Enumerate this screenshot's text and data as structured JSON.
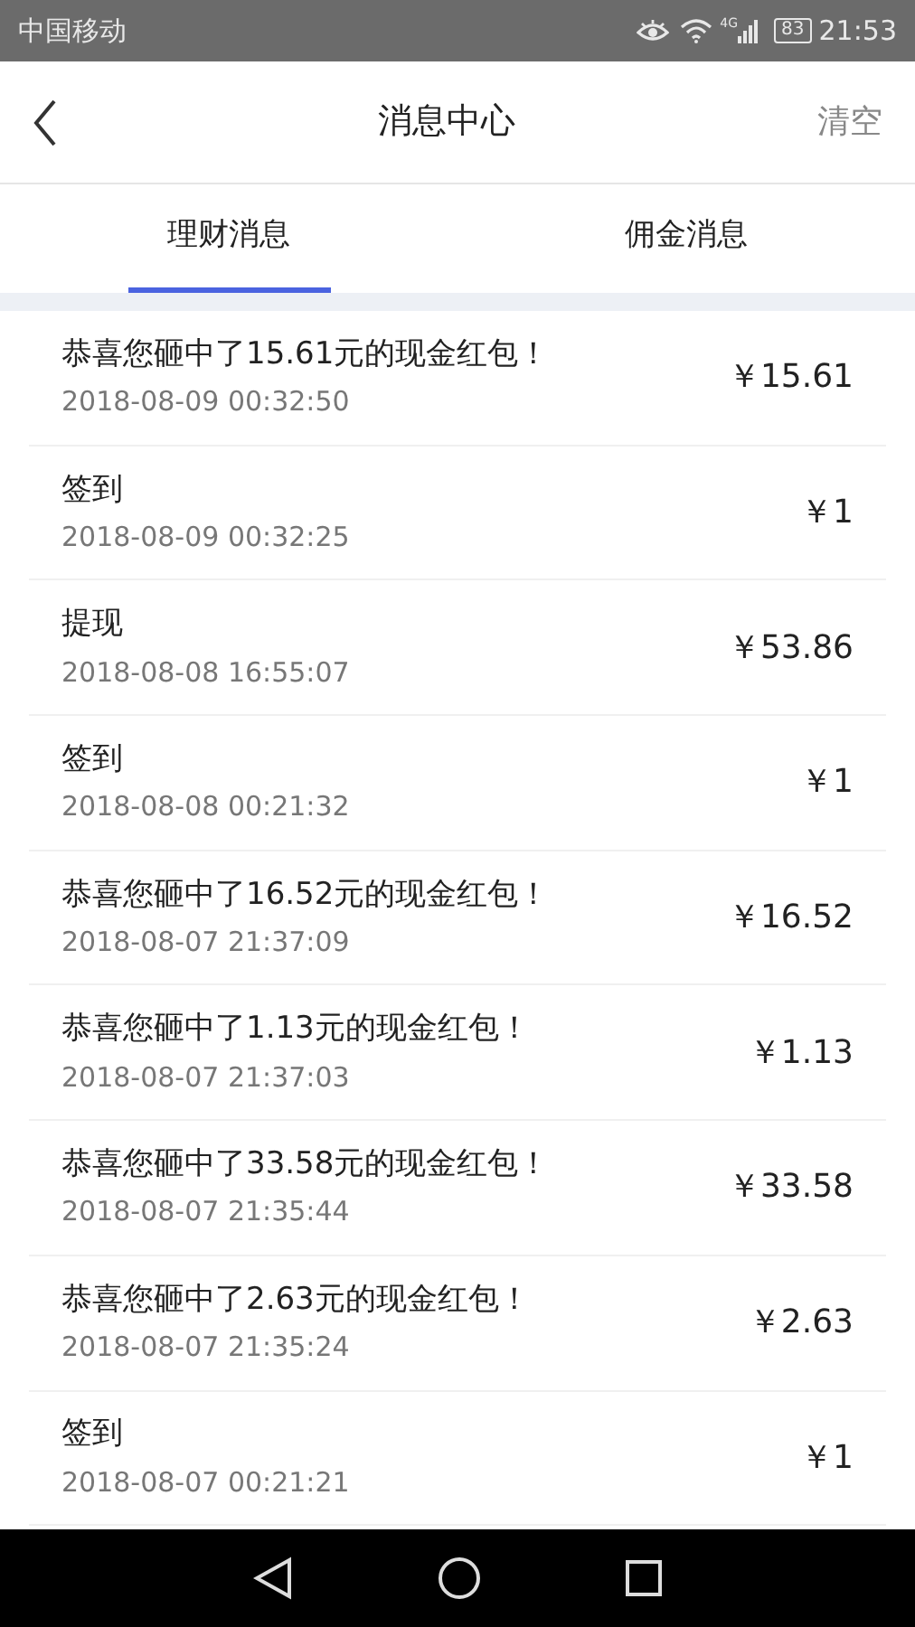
{
  "status_bar": {
    "carrier": "中国移动",
    "network": "4G",
    "battery": "83",
    "time": "21:53"
  },
  "header": {
    "title": "消息中心",
    "action": "清空"
  },
  "tabs": [
    {
      "label": "理财消息",
      "selected": true
    },
    {
      "label": "佣金消息",
      "selected": false
    }
  ],
  "messages": [
    {
      "title": "恭喜您砸中了15.61元的现金红包！",
      "time": "2018-08-09 00:32:50",
      "amount": "￥15.61"
    },
    {
      "title": "签到",
      "time": "2018-08-09 00:32:25",
      "amount": "￥1"
    },
    {
      "title": "提现",
      "time": "2018-08-08 16:55:07",
      "amount": "￥53.86"
    },
    {
      "title": "签到",
      "time": "2018-08-08 00:21:32",
      "amount": "￥1"
    },
    {
      "title": "恭喜您砸中了16.52元的现金红包！",
      "time": "2018-08-07 21:37:09",
      "amount": "￥16.52"
    },
    {
      "title": "恭喜您砸中了1.13元的现金红包！",
      "time": "2018-08-07 21:37:03",
      "amount": "￥1.13"
    },
    {
      "title": "恭喜您砸中了33.58元的现金红包！",
      "time": "2018-08-07 21:35:44",
      "amount": "￥33.58"
    },
    {
      "title": "恭喜您砸中了2.63元的现金红包！",
      "time": "2018-08-07 21:35:24",
      "amount": "￥2.63"
    },
    {
      "title": "签到",
      "time": "2018-08-07 00:21:21",
      "amount": "￥1"
    }
  ]
}
